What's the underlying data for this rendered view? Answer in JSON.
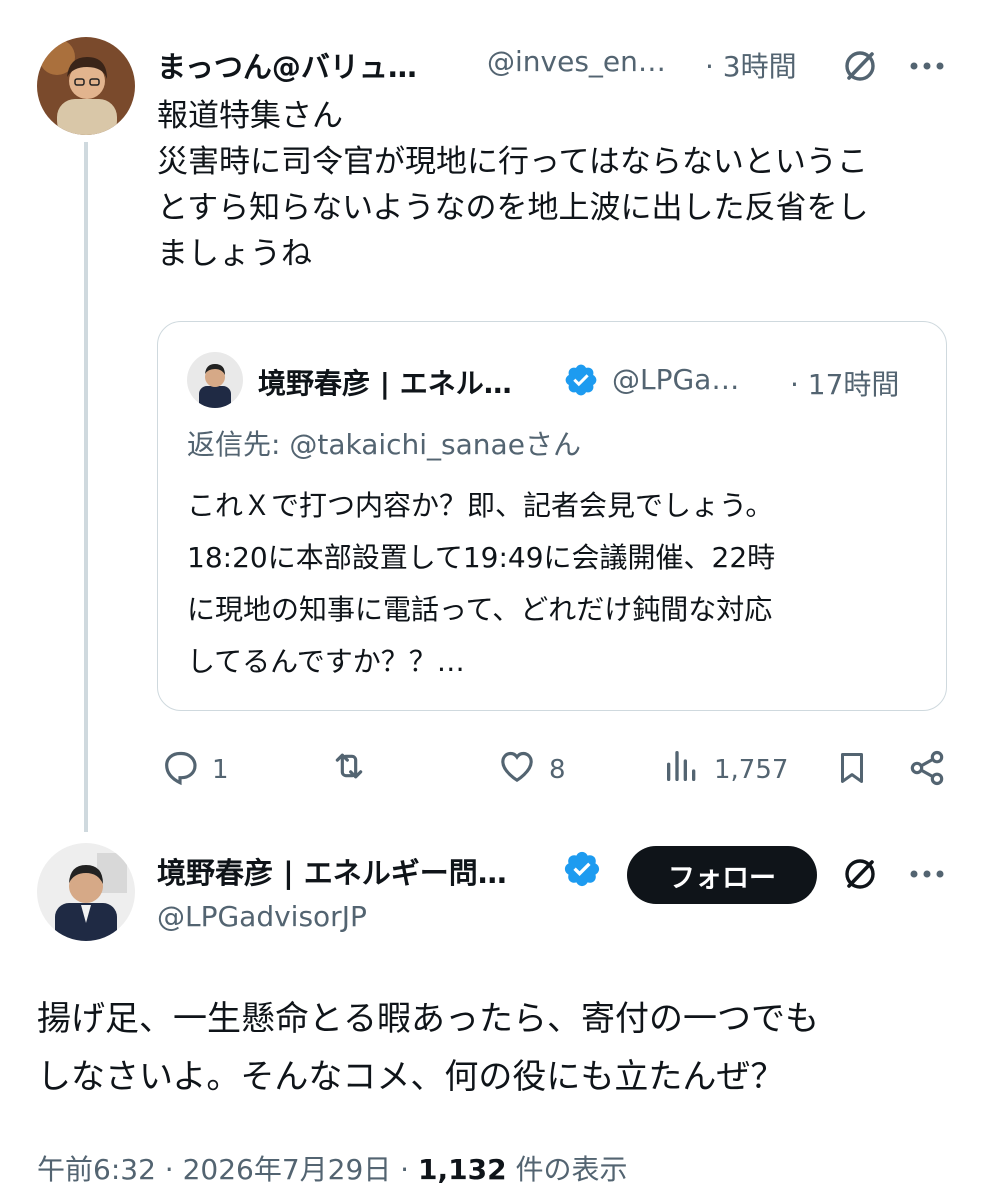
{
  "post1": {
    "display_name": "まっつん@バリュ…",
    "handle": "@inves_en…",
    "time": "· 3時間",
    "text_lines": [
      "報道特集さん",
      "災害時に司令官が現地に行ってはならないというこ",
      "とすら知らないようなのを地上波に出した反省をし",
      "ましょうね"
    ],
    "metrics": {
      "replies": "1",
      "likes": "8",
      "views": "1,757"
    }
  },
  "quote": {
    "display_name": "境野春彦 | エネル…",
    "handle": "@LPGa…",
    "time": "· 17時間",
    "reply_to_prefix": "返信先: ",
    "reply_to_handle": "@takaichi_sanae",
    "reply_to_suffix": "さん",
    "text_lines": [
      "これＸで打つ内容か？即、記者会見でしょう。",
      "18:20に本部設置して19:49に会議開催、22時",
      "に現地の知事に電話って、どれだけ鈍間な対応",
      "してるんですか？？…"
    ]
  },
  "post2": {
    "display_name": "境野春彦 | エネルギー問…",
    "handle": "@LPGadvisorJP",
    "follow_label": "フォロー",
    "text_lines": [
      "揚げ足、一生懸命とる暇あったら、寄付の一つでも",
      "しなさいよ。そんなコメ、何の役にも立たんぜ？"
    ],
    "footer_time": "午前6:32 · 2026年7月29日 · ",
    "footer_views": "1,132",
    "footer_views_suffix": " 件の表示"
  },
  "colors": {
    "verified": "#1d9bf0",
    "follow_bg": "#0f1419",
    "thread_line": "#cfd9de"
  },
  "icons": [
    "grok-icon",
    "more-icon",
    "verified-badge-icon",
    "reply-icon",
    "repost-icon",
    "like-icon",
    "views-icon",
    "bookmark-icon",
    "share-icon"
  ]
}
